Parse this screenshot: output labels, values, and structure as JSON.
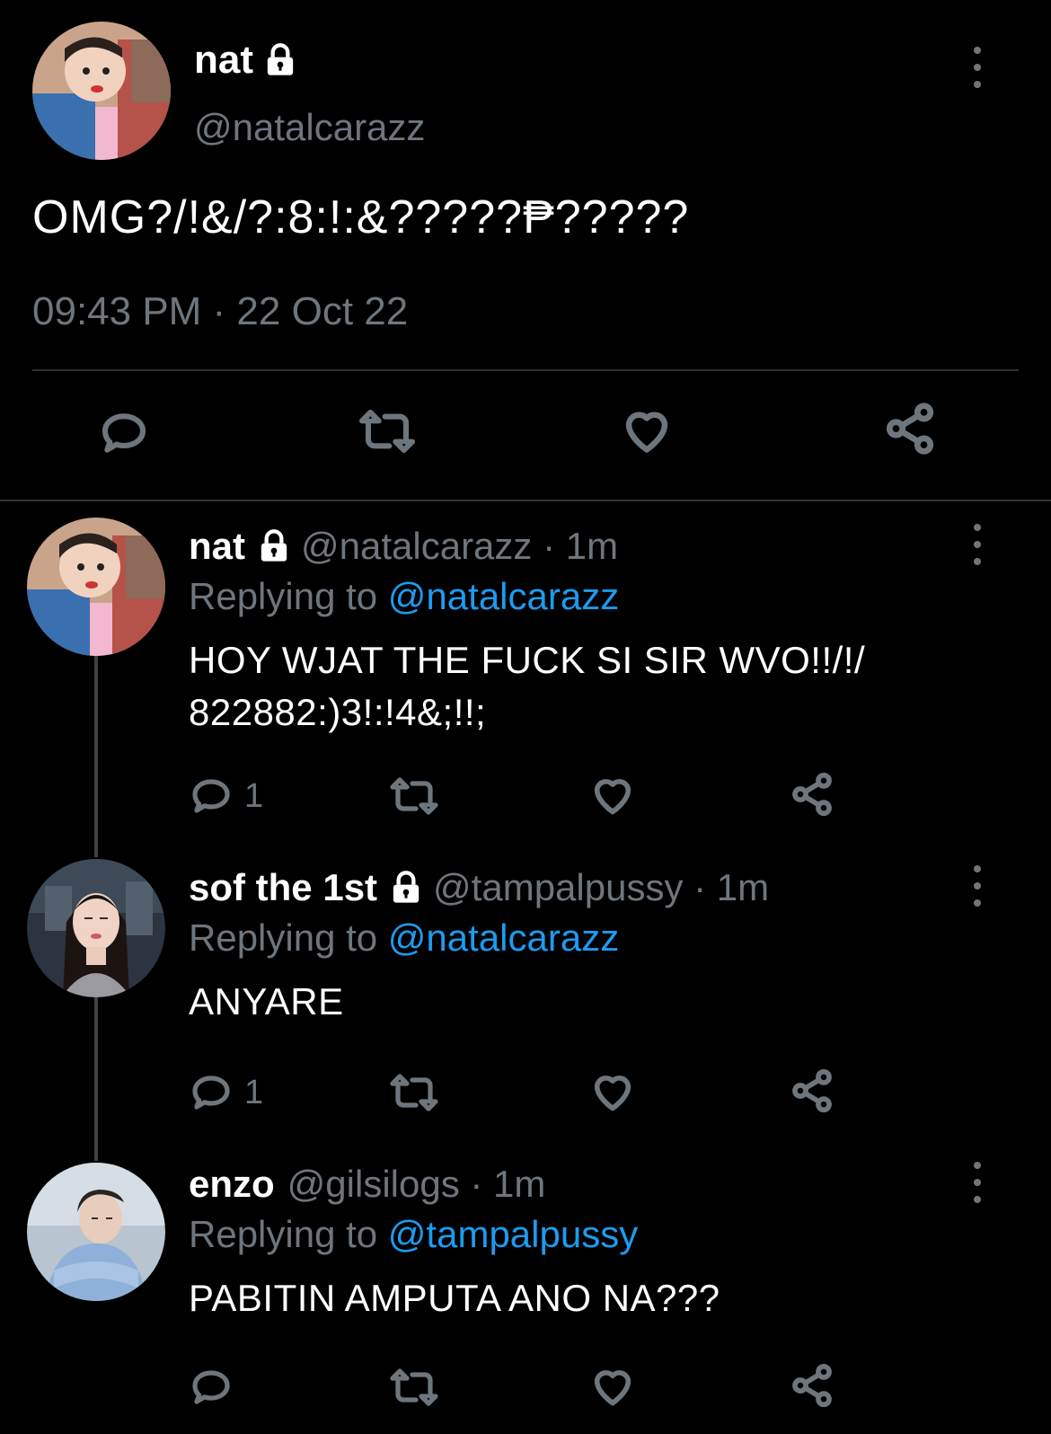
{
  "main_tweet": {
    "name": "nat",
    "handle": "@natalcarazz",
    "text": "OMG?/!&/?:8:!:&?????₱?????",
    "timestamp": "09:43 PM · 22 Oct 22",
    "locked": true
  },
  "replies": [
    {
      "name": "nat",
      "handle": "@natalcarazz",
      "time_sep": " · ",
      "time": "1m",
      "replying_label": "Replying to ",
      "replying_to": "@natalcarazz",
      "text": "HOY WJAT THE FUCK SI SIR WVO!!/!/\n822882:)3!:!4&;!!;",
      "reply_count": "1",
      "locked": true
    },
    {
      "name": "sof the 1st",
      "handle": "@tampalpussy",
      "time_sep": " · ",
      "time": "1m",
      "replying_label": "Replying to ",
      "replying_to": "@natalcarazz",
      "text": "ANYARE",
      "reply_count": "1",
      "locked": true
    },
    {
      "name": "enzo",
      "handle": "@gilsilogs",
      "time_sep": " · ",
      "time": "1m",
      "replying_label": "Replying to ",
      "replying_to": "@tampalpussy",
      "text": "PABITIN AMPUTA ANO NA???",
      "reply_count": "",
      "locked": false
    }
  ],
  "icons": [
    "reply-icon",
    "retweet-icon",
    "like-icon",
    "share-icon",
    "more-icon",
    "lock-icon"
  ],
  "colors": {
    "background": "#000000",
    "muted": "#6e767d",
    "mention": "#1d9bf0",
    "divider": "#2f3336"
  }
}
